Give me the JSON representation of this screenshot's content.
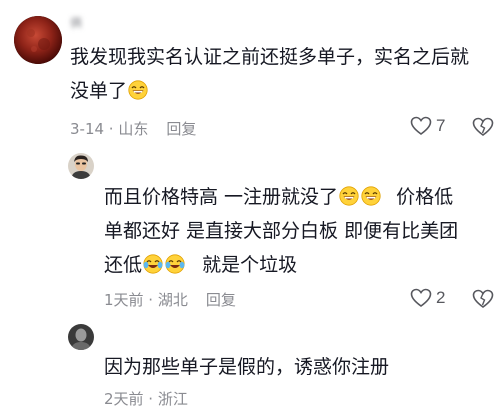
{
  "comments": [
    {
      "username": "俩",
      "text_lines": [
        "我发现我实名认证之前还挺多单子，实名之后就",
        "没单了"
      ],
      "emoji": "laugh-emoji",
      "date": "3-14 · 山东",
      "reply_label": "回复",
      "likes": "7"
    },
    {
      "username": "",
      "text_line1_a": "而且价格特高 一注册就没了",
      "text_line1_b": "价格低",
      "text_line2": "单都还好 是直接大部分白板 即便有比美团",
      "text_line3_a": "还低",
      "text_line3_b": "就是个垃圾",
      "date": "1天前 · 湖北",
      "reply_label": "回复",
      "likes": "2"
    },
    {
      "username": "",
      "text": "因为那些单子是假的，诱惑你注册",
      "date": "2天前 · 浙江"
    }
  ],
  "colors": {
    "text": "#161823",
    "meta": "#8a8b91",
    "avatar1": "#7a1a14"
  }
}
